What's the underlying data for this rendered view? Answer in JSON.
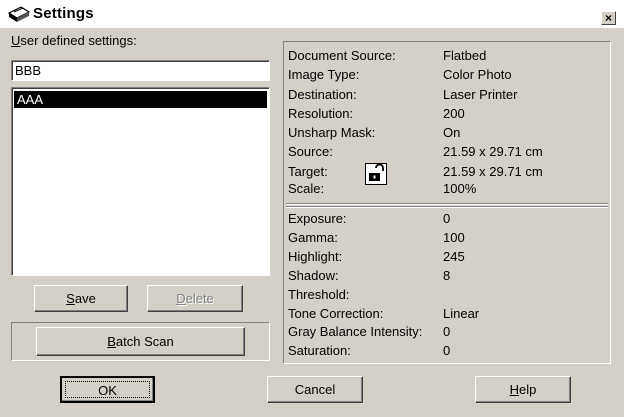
{
  "window": {
    "title": "Settings",
    "icon": "scanner-icon",
    "close_glyph": "×"
  },
  "left": {
    "label_prefix_underlined": "U",
    "label_rest": "ser defined settings:",
    "name_value": "BBB",
    "list_items": [
      {
        "label": "AAA",
        "selected": true
      }
    ],
    "save_underlined": "S",
    "save_rest": "ave",
    "delete_underlined": "D",
    "delete_rest": "elete",
    "batch_underlined": "B",
    "batch_rest": "atch Scan"
  },
  "info_top": [
    {
      "label": "Document Source:",
      "value": "Flatbed"
    },
    {
      "label": "Image Type:",
      "value": "Color Photo"
    },
    {
      "label": "Destination:",
      "value": "Laser Printer"
    },
    {
      "label": "Resolution:",
      "value": "200"
    },
    {
      "label": "Unsharp Mask:",
      "value": "On"
    },
    {
      "label": "Source:",
      "value": "21.59 x 29.71 cm"
    },
    {
      "label": "Target:",
      "value": "21.59 x 29.71 cm"
    },
    {
      "label": "Scale:",
      "value": "100%"
    }
  ],
  "info_bottom": [
    {
      "label": "Exposure:",
      "value": "0"
    },
    {
      "label": " Gamma:",
      "value": "100"
    },
    {
      "label": "Highlight:",
      "value": "245"
    },
    {
      "label": "Shadow:",
      "value": "8"
    },
    {
      "label": "Threshold:",
      "value": ""
    },
    {
      "label": "Tone Correction:",
      "value": "Linear"
    },
    {
      "label": "Gray Balance Intensity:",
      "value": "0"
    },
    {
      "label": "Saturation:",
      "value": "0"
    }
  ],
  "footer": {
    "ok_label": "OK",
    "cancel_label": "Cancel",
    "help_underlined": "H",
    "help_rest": "elp"
  },
  "lock_icon": "lock-icon"
}
